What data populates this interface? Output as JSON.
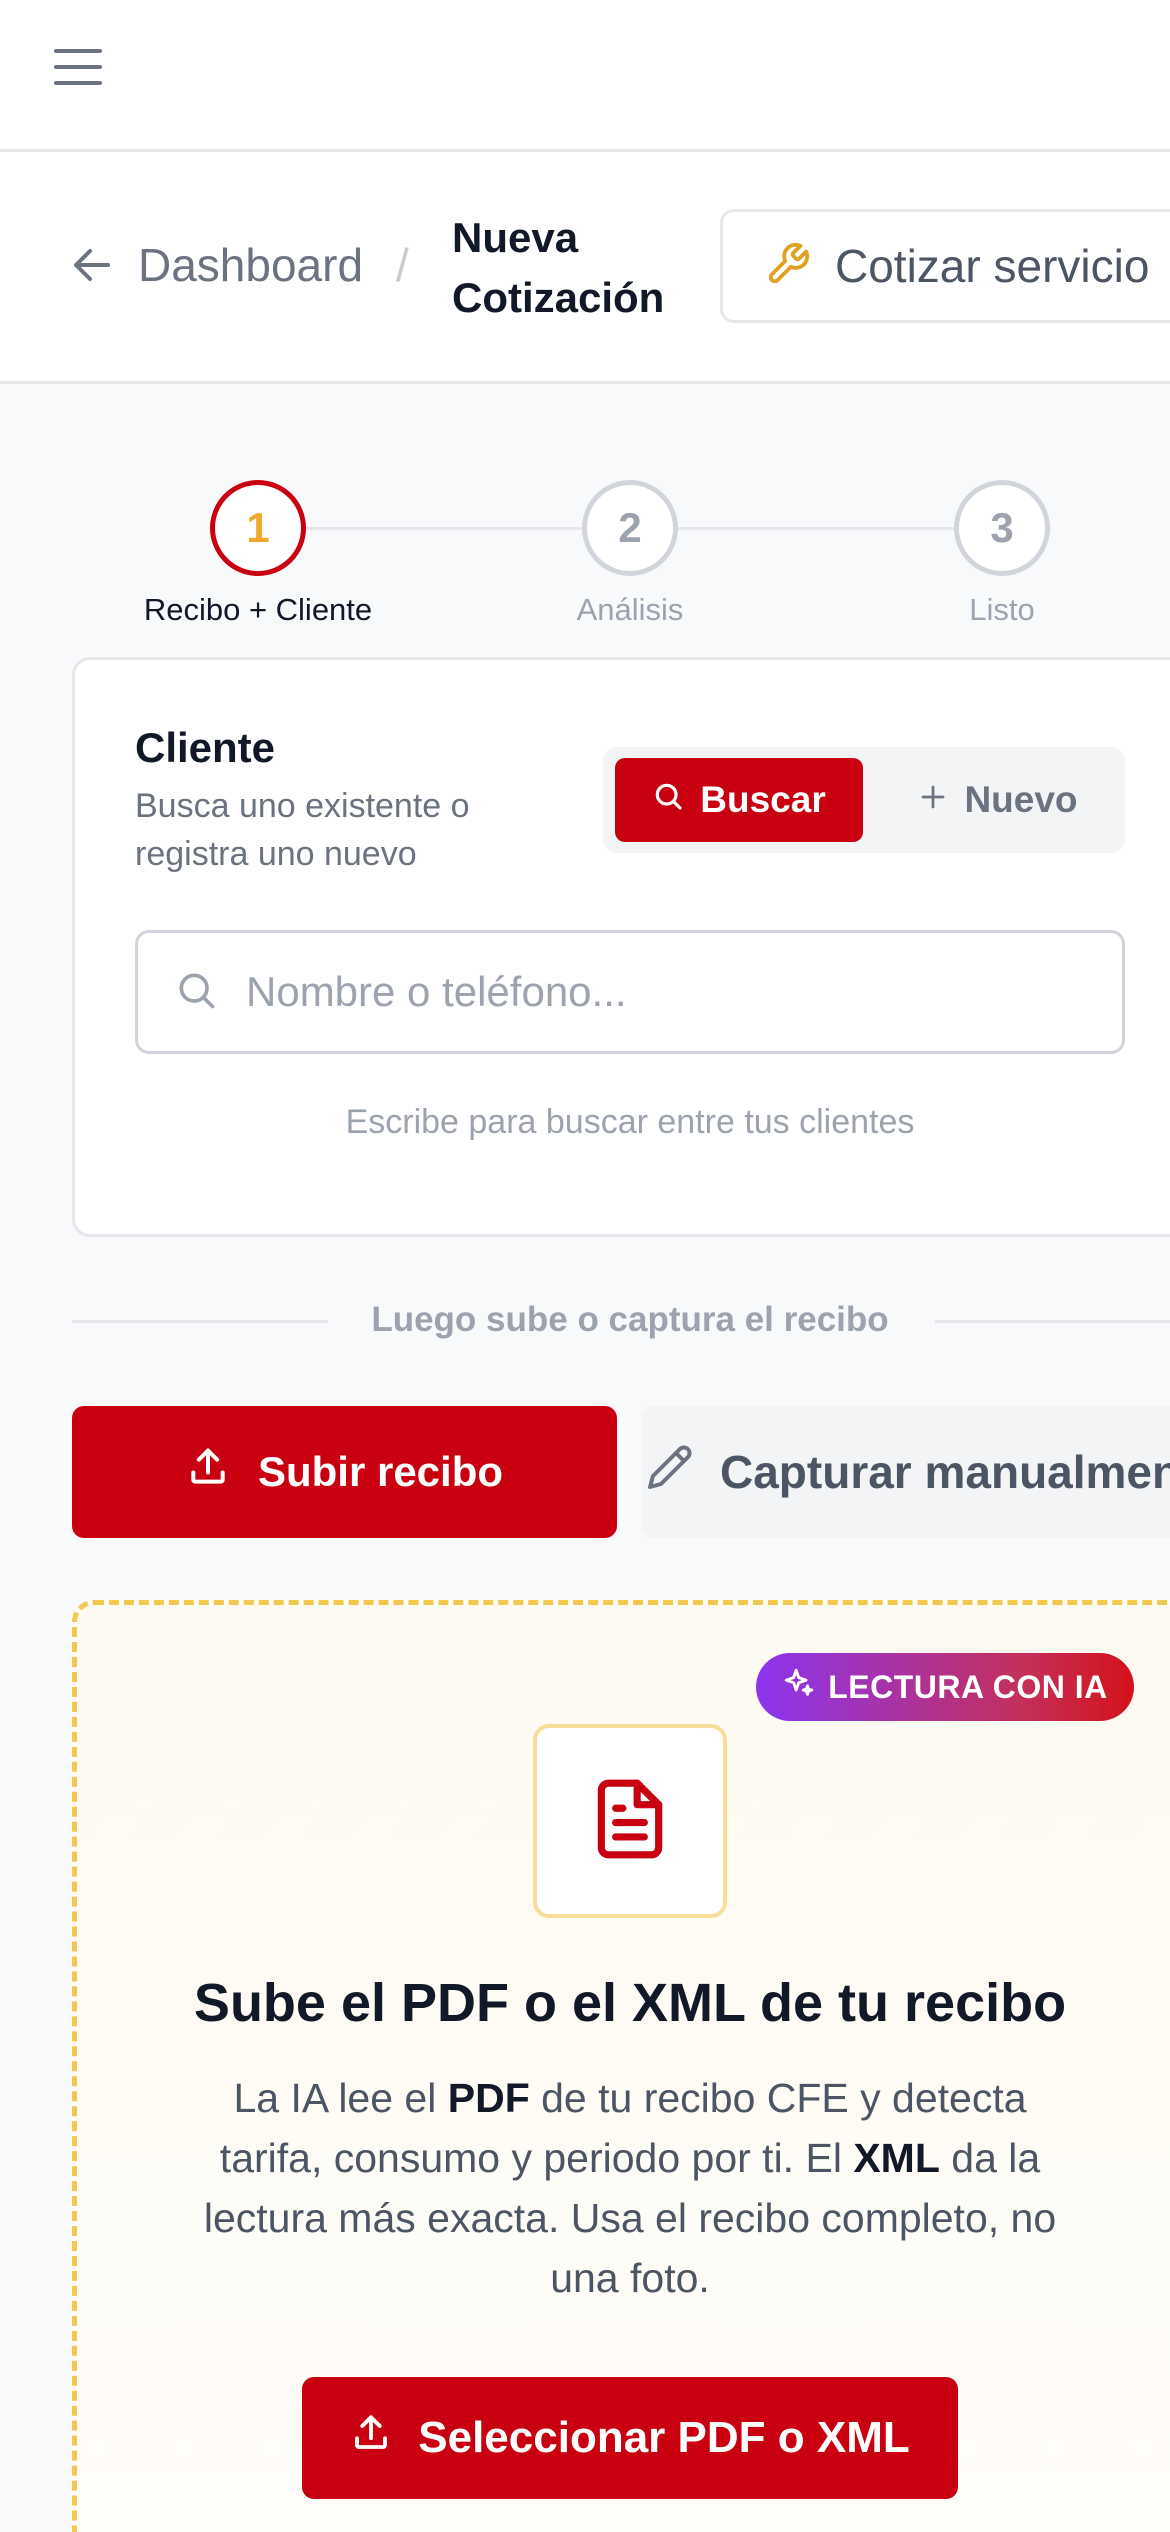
{
  "breadcrumb": {
    "parent": "Dashboard",
    "separator": "/",
    "current": "Nueva Cotización"
  },
  "header": {
    "cotizar_label": "Cotizar servicio"
  },
  "stepper": {
    "steps": [
      {
        "number": "1",
        "label": "Recibo + Cliente",
        "state": "active"
      },
      {
        "number": "2",
        "label": "Análisis",
        "state": "pending"
      },
      {
        "number": "3",
        "label": "Listo",
        "state": "pending"
      }
    ]
  },
  "cliente": {
    "title": "Cliente",
    "subtitle": "Busca uno existente o registra uno nuevo",
    "buscar_label": "Buscar",
    "nuevo_label": "Nuevo",
    "search_placeholder": "Nombre o teléfono...",
    "search_value": "",
    "hint": "Escribe para buscar entre tus clientes"
  },
  "recibo": {
    "divider_text": "Luego sube o captura el recibo",
    "upload_label": "Subir recibo",
    "manual_label": "Capturar manualmente",
    "badge": "LECTURA CON IA",
    "title": "Sube el PDF o el XML de tu recibo",
    "desc_parts": [
      "La IA lee el ",
      "PDF",
      " de tu recibo CFE y detecta tarifa, consumo y periodo por ti. El ",
      "XML",
      " da la lectura más exacta. Usa el recibo completo, no una foto."
    ],
    "select_label": "Seleccionar PDF o XML"
  },
  "colors": {
    "brand_red": "#c8000f",
    "step_active_ring": "#c8000f",
    "step_active_number": "#f0a92c",
    "dropzone_border": "#f2c851",
    "badge_start": "#8b35f0",
    "badge_end": "#d4121a",
    "icon_accent": "#e0a020"
  },
  "icons": {
    "menu": "hamburger-icon",
    "back": "arrow-left-icon",
    "cotizar": "wrench-icon",
    "buscar": "search-icon",
    "nuevo": "plus-icon",
    "search_field": "search-icon",
    "upload": "upload-icon",
    "manual": "pencil-icon",
    "badge": "sparkles-icon",
    "doc": "document-icon",
    "select": "upload-icon"
  }
}
